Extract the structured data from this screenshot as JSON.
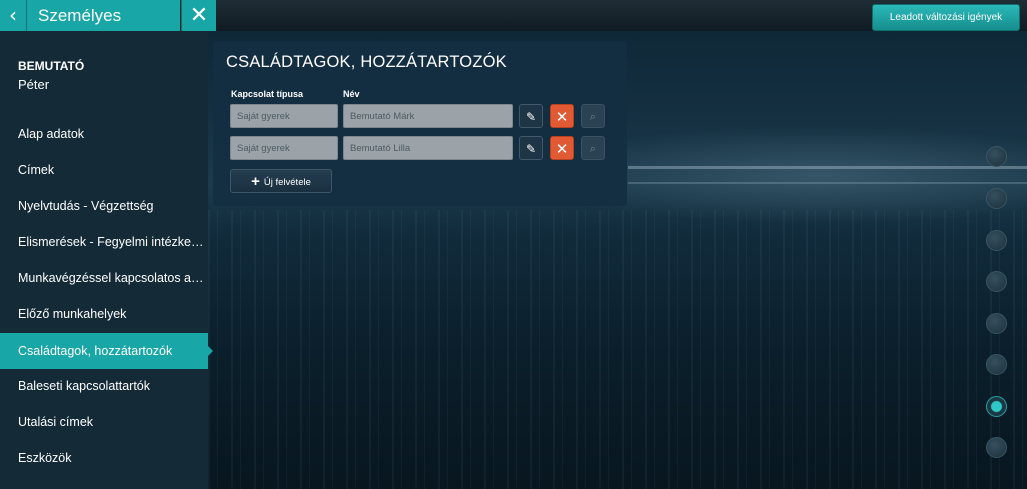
{
  "header": {
    "back_icon": "chevron-left-icon",
    "title": "Személyes adataim",
    "close_icon": "close-icon",
    "requests_button": "Leadott változási igények"
  },
  "user": {
    "title": "BEMUTATÓ",
    "name": "Péter"
  },
  "sidebar": {
    "items": [
      {
        "label": "Alap adatok"
      },
      {
        "label": "Címek"
      },
      {
        "label": "Nyelvtudás - Végzettség"
      },
      {
        "label": "Elismerések - Fegyelmi intézkedések"
      },
      {
        "label": "Munkavégzéssel kapcsolatos adatok"
      },
      {
        "label": "Előző munkahelyek"
      },
      {
        "label": "Családtagok, hozzátartozók"
      },
      {
        "label": "Baleseti kapcsolattartók"
      },
      {
        "label": "Utalási címek"
      },
      {
        "label": "Eszközök"
      }
    ],
    "active_index": 6
  },
  "panel": {
    "title": "CSALÁDTAGOK, HOZZÁTARTOZÓK",
    "columns": {
      "type": "Kapcsolat típusa",
      "name": "Név"
    },
    "rows": [
      {
        "type": "Saját gyerek",
        "name": "Bemutató Márk"
      },
      {
        "type": "Saját gyerek",
        "name": "Bemutató Lilla"
      }
    ],
    "add_button": "Új felvétele"
  },
  "accent_color": "#19a6a6",
  "delete_color": "#e15a33",
  "page_dots": {
    "count": 8,
    "active_index": 6
  }
}
